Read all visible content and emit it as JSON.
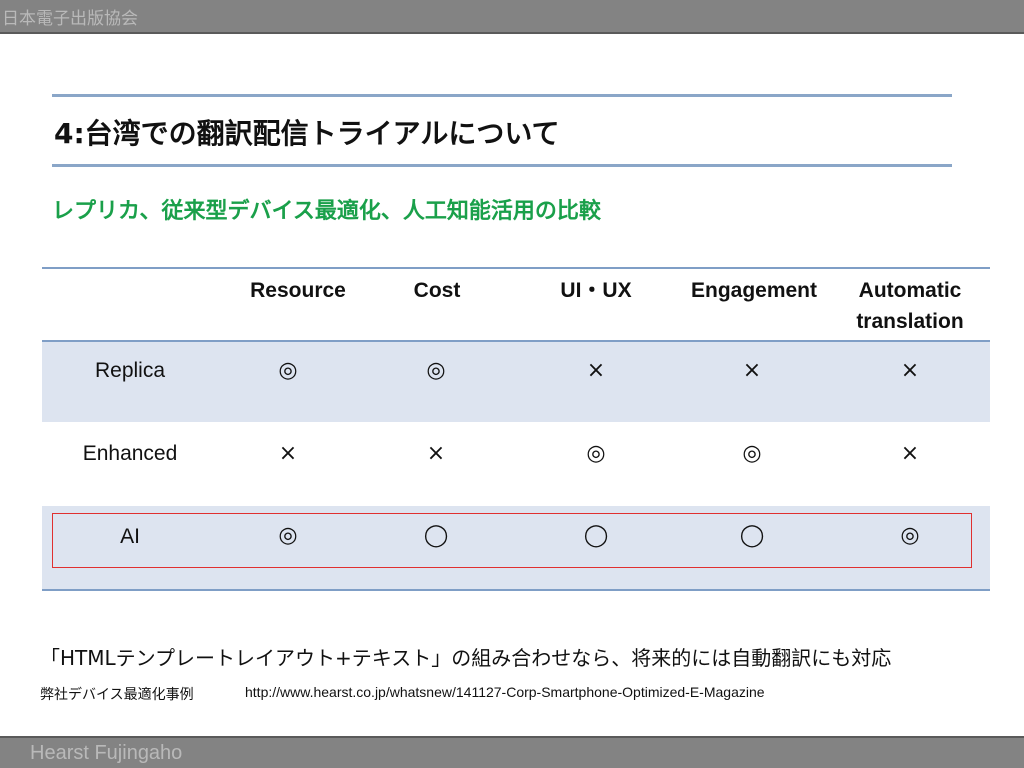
{
  "header": {
    "org": "日本電子出版協会"
  },
  "slide": {
    "title": "4:台湾での翻訳配信トライアルについて",
    "subtitle": "レプリカ、従来型デバイス最適化、人工知能活用の比較"
  },
  "table": {
    "columns": [
      "Resource",
      "Cost",
      "UI・UX",
      "Engagement",
      "Automatic translation"
    ],
    "columns_lines": [
      [
        "Resource"
      ],
      [
        "Cost"
      ],
      [
        "UI・UX"
      ],
      [
        "Engagement"
      ],
      [
        "Automatic",
        "translation"
      ]
    ],
    "rows": [
      {
        "label": "Replica",
        "cells": [
          "◎",
          "◎",
          "×",
          "×",
          "×"
        ]
      },
      {
        "label": "Enhanced",
        "cells": [
          "×",
          "×",
          "◎",
          "◎",
          "×"
        ]
      },
      {
        "label": "AI",
        "cells": [
          "◎",
          "◯",
          "◯",
          "◯",
          "◎"
        ]
      }
    ]
  },
  "notes": {
    "line1": "「HTMLテンプレートレイアウト+テキスト」の組み合わせなら、将来的には自動翻訳にも対応",
    "example_label": "弊社デバイス最適化事例",
    "example_url": "http://www.hearst.co.jp/whatsnew/141127-Corp-Smartphone-Optimized-E-Magazine"
  },
  "footer": {
    "company": "Hearst Fujingaho"
  },
  "colors": {
    "bar": "#838383",
    "rule": "#8aa6c8",
    "subtitle": "#1aa04a",
    "band": "#dde4f0",
    "highlight": "#e03030"
  }
}
